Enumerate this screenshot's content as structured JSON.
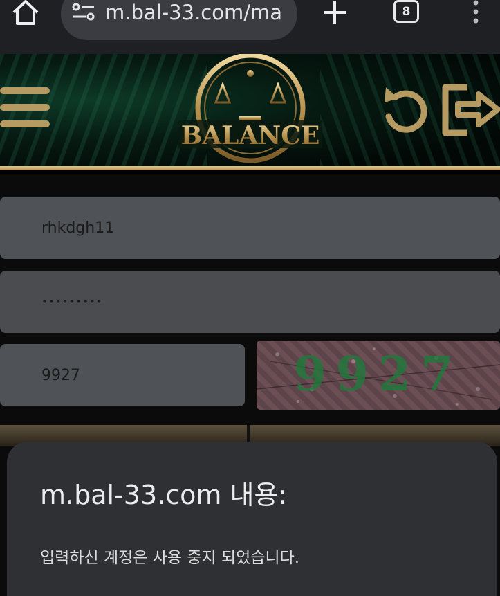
{
  "browser": {
    "url": "m.bal-33.com/ma",
    "tab_count": "8"
  },
  "site": {
    "logo_text": "BALANCE"
  },
  "login_form": {
    "username_value": "rhkdgh11",
    "password_value": "•••••••••",
    "captcha_input_value": "9927",
    "captcha_image_text": "9927"
  },
  "alert_dialog": {
    "title": "m.bal-33.com 내용:",
    "message": "입력하신 계정은 사용 중지 되었습니다."
  },
  "colors": {
    "browser_bar": "#1f2023",
    "gold_accent": "#c9a968",
    "dialog_bg": "#2f3033",
    "captcha_green": "#1f7a3c"
  }
}
